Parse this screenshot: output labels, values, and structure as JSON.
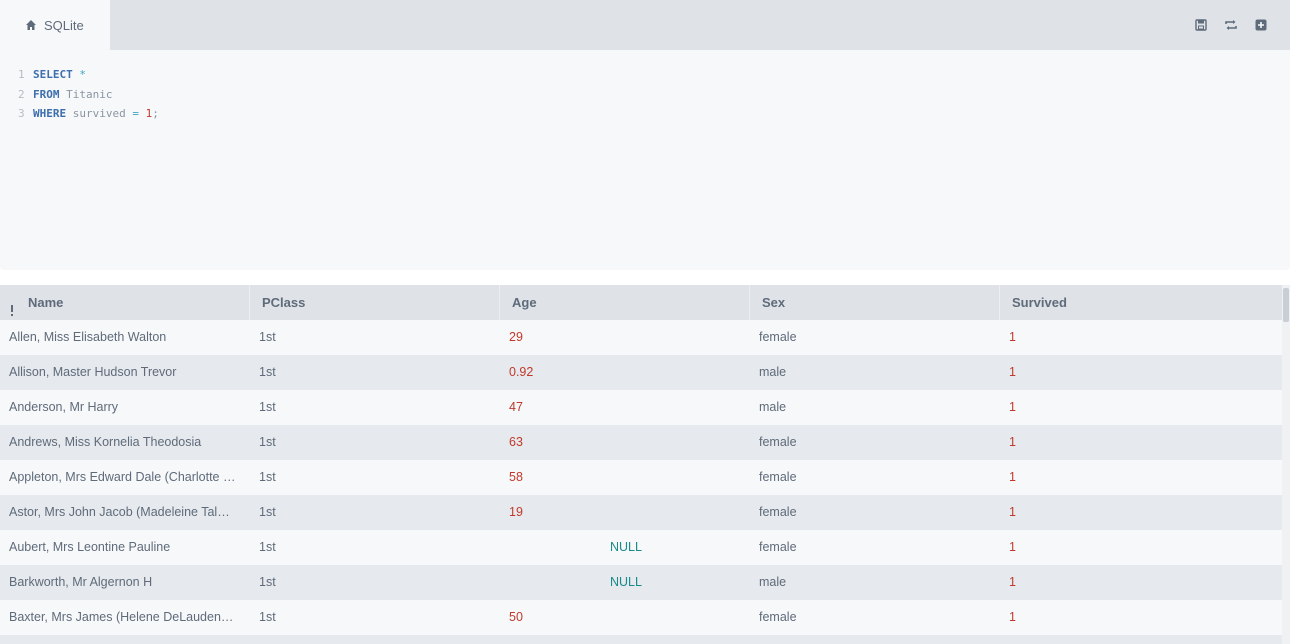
{
  "tab": {
    "label": "SQLite",
    "icon": "home-icon"
  },
  "toolbar": {
    "save_icon": "save-icon",
    "refresh_icon": "refresh-icon",
    "add_icon": "plus-square-icon"
  },
  "editor": {
    "lines": [
      {
        "num": "1",
        "tokens": [
          {
            "t": "SELECT",
            "c": "kw"
          },
          {
            "t": " ",
            "c": "id"
          },
          {
            "t": "*",
            "c": "op"
          }
        ]
      },
      {
        "num": "2",
        "tokens": [
          {
            "t": "FROM",
            "c": "kw"
          },
          {
            "t": " Titanic",
            "c": "id"
          }
        ]
      },
      {
        "num": "3",
        "tokens": [
          {
            "t": "WHERE",
            "c": "kw"
          },
          {
            "t": " survived ",
            "c": "id"
          },
          {
            "t": "=",
            "c": "op"
          },
          {
            "t": " ",
            "c": "id"
          },
          {
            "t": "1",
            "c": "num"
          },
          {
            "t": ";",
            "c": "punc"
          }
        ]
      }
    ]
  },
  "table": {
    "columns": [
      "Name",
      "PClass",
      "Age",
      "Sex",
      "Survived"
    ],
    "rows": [
      [
        "Allen, Miss Elisabeth Walton",
        "1st",
        "29",
        "female",
        "1"
      ],
      [
        "Allison, Master Hudson Trevor",
        "1st",
        "0.92",
        "male",
        "1"
      ],
      [
        "Anderson, Mr Harry",
        "1st",
        "47",
        "male",
        "1"
      ],
      [
        "Andrews, Miss Kornelia Theodosia",
        "1st",
        "63",
        "female",
        "1"
      ],
      [
        "Appleton, Mrs Edward Dale (Charlotte Lamson)",
        "1st",
        "58",
        "female",
        "1"
      ],
      [
        "Astor, Mrs John Jacob (Madeleine Talmadge Force)",
        "1st",
        "19",
        "female",
        "1"
      ],
      [
        "Aubert, Mrs Leontine Pauline",
        "1st",
        "NULL",
        "female",
        "1"
      ],
      [
        "Barkworth, Mr Algernon H",
        "1st",
        "NULL",
        "male",
        "1"
      ],
      [
        "Baxter, Mrs James (Helene DeLaudeneire Chaput)",
        "1st",
        "50",
        "female",
        "1"
      ],
      [
        "",
        "",
        "",
        "",
        ""
      ]
    ]
  },
  "colors": {
    "null_value": "#1a8a8a",
    "numeric_value": "#c0392b",
    "header_bg": "#dfe2e7"
  }
}
